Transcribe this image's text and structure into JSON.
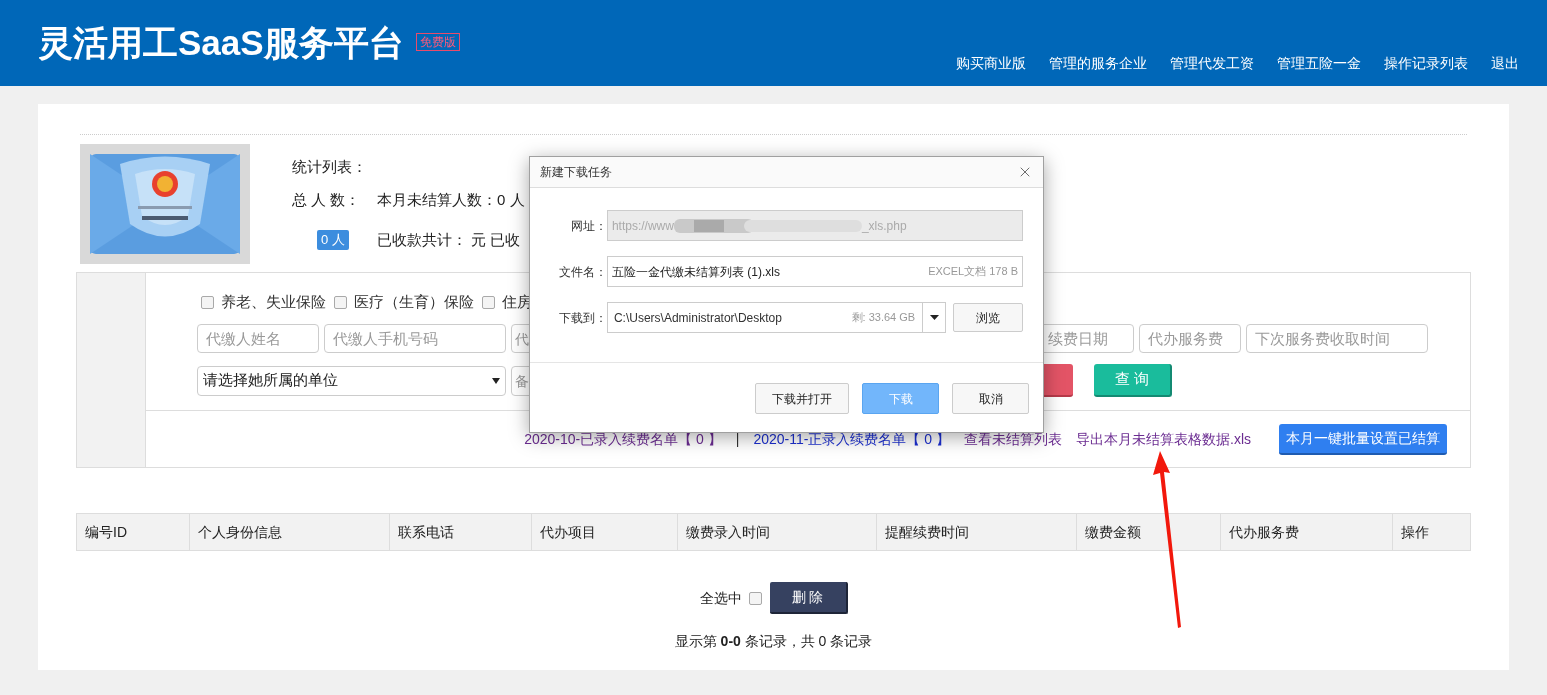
{
  "header": {
    "title": "灵活用工SaaS服务平台",
    "badge": "免费版",
    "nav": [
      "购买商业版",
      "管理的服务企业",
      "管理代发工资",
      "管理五险一金",
      "操作记录列表",
      "退出"
    ]
  },
  "stats": {
    "title": "统计列表：",
    "total_label": "总 人 数：",
    "unsettled": "本月未结算人数：0 人",
    "count_badge": "0 人",
    "received": "已收款共计： 元  已收"
  },
  "filter": {
    "checkboxes": [
      {
        "label": "养老、失业保险",
        "checked": false
      },
      {
        "label": "医疗（生育）保险",
        "checked": false
      },
      {
        "label": "住房",
        "checked": false
      }
    ],
    "fields": [
      {
        "placeholder": "代缴人姓名"
      },
      {
        "placeholder": "代缴人手机号码"
      },
      {
        "placeholder": "代"
      },
      {
        "placeholder": "续费日期"
      },
      {
        "placeholder": "代办服务费"
      },
      {
        "placeholder": "下次服务费收取时间"
      }
    ],
    "select": "请选择她所属的单位",
    "note_field_placeholder": "备",
    "query_button": "查 询",
    "links": [
      {
        "text": "2020-10-已录入续费名单【 0 】",
        "visited": true
      },
      {
        "text": "|",
        "kind": "separator"
      },
      {
        "text": "2020-11-正录入续费名单【 0 】",
        "visited": false
      },
      {
        "text": "查看未结算列表",
        "visited": true
      },
      {
        "text": "导出本月未结算表格数据.xls",
        "visited": true
      }
    ],
    "batch_button": "本月一键批量设置已结算"
  },
  "table": {
    "columns": [
      "编号ID",
      "个人身份信息",
      "联系电话",
      "代办项目",
      "缴费录入时间",
      "提醒续费时间",
      "缴费金额",
      "代办服务费",
      "操作"
    ]
  },
  "footer": {
    "select_all": {
      "label": "全选中",
      "checked": false
    },
    "delete_button": "删 除",
    "summary": "显示第 **0-0** 条记录，共 0 条记录"
  },
  "dialog": {
    "title": "新建下载任务",
    "url": {
      "label": "网址：",
      "prefix": "https://www",
      "suffix": "_xls.php"
    },
    "filename": {
      "label": "文件名：",
      "value": "五险一金代缴未结算列表 (1).xls",
      "info": "EXCEL文档 178 B"
    },
    "path": {
      "label": "下载到：",
      "value": "C:\\Users\\Administrator\\Desktop",
      "free": "剩: 33.64 GB"
    },
    "browse": "浏览",
    "buttons": [
      {
        "label": "下载并打开",
        "primary": false
      },
      {
        "label": "下载",
        "primary": true
      },
      {
        "label": "取消",
        "primary": false
      }
    ]
  }
}
